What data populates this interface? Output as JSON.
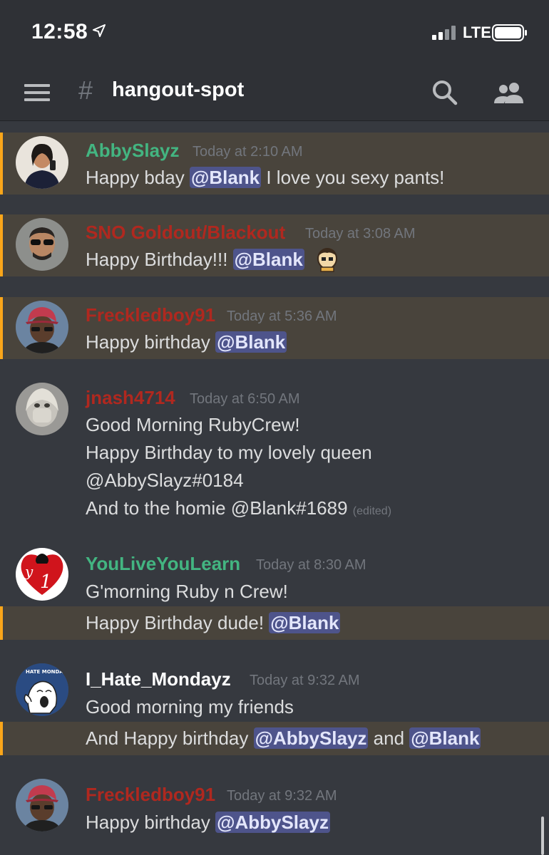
{
  "status_bar": {
    "time": "12:58",
    "network": "LTE",
    "icons": [
      "location-arrow-icon",
      "signal-bars-icon",
      "battery-icon"
    ]
  },
  "header": {
    "channel_name": "hangout-spot",
    "icons": [
      "menu-icon",
      "hash-icon",
      "search-icon",
      "members-icon"
    ]
  },
  "colors": {
    "background": "#36393f",
    "header": "#2f3136",
    "mention_highlight": "#49443c",
    "mention_bar": "#faa61a",
    "mention_pill": "#4e548b",
    "username_green": "#43b581",
    "username_red": "#b0281f",
    "username_white": "#ffffff"
  },
  "messages": [
    {
      "author": "AbbySlayz",
      "timestamp": "Today at 2:10 AM",
      "line1": {
        "pre": "Happy bday ",
        "mention": "@Blank",
        "post": " I love you sexy pants!"
      }
    },
    {
      "author": "SNO Goldout/Blackout",
      "timestamp": "Today at 3:08 AM",
      "line1": {
        "pre": "Happy Birthday!!! ",
        "mention": "@Blank"
      }
    },
    {
      "author": "Freckledboy91",
      "timestamp": "Today at 5:36 AM",
      "line1": {
        "pre": "Happy birthday ",
        "mention": "@Blank"
      }
    },
    {
      "author": "jnash4714",
      "timestamp": "Today at 6:50 AM",
      "lines": [
        "Good Morning RubyCrew!",
        "Happy Birthday to my lovely queen",
        "@AbbySlayz#0184",
        "And to the homie @Blank#1689"
      ],
      "edited": "(edited)"
    },
    {
      "author": "YouLiveYouLearn",
      "timestamp": "Today at 8:30 AM",
      "line1": "G'morning Ruby n Crew!",
      "line2": {
        "pre": "Happy Birthday dude! ",
        "mention": "@Blank"
      }
    },
    {
      "author": "I_Hate_Mondayz",
      "timestamp": "Today at 9:32 AM",
      "avatar_text": "HATE MONDAYS",
      "line1": "Good morning my friends",
      "line2": {
        "pre": "And Happy birthday ",
        "mention_a": "@AbbySlayz",
        "mid": " and ",
        "mention_b": "@Blank"
      }
    },
    {
      "author": "Freckledboy91",
      "timestamp": "Today at 9:32 AM",
      "line1": {
        "pre": "Happy birthday ",
        "mention": "@AbbySlayz"
      }
    }
  ]
}
